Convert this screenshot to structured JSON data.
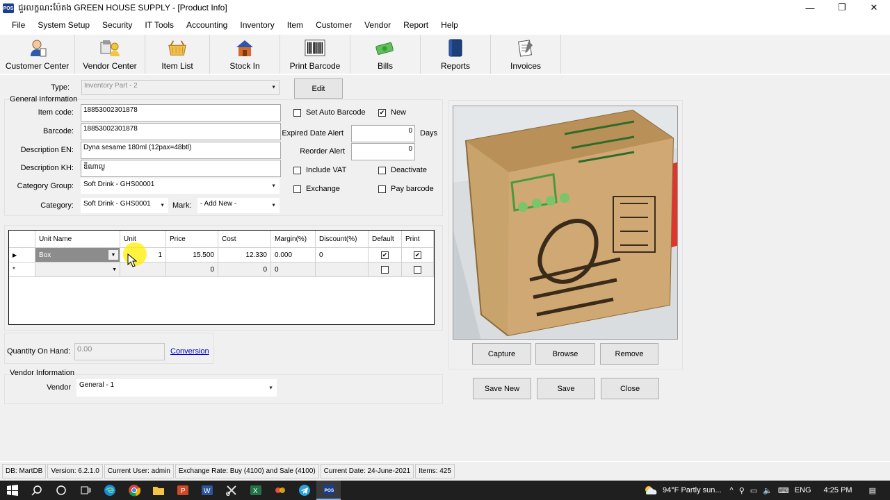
{
  "window": {
    "title": "ជួរលក្ខណះប៉ែតង GREEN HOUSE SUPPLY - [Product Info]",
    "app_icon": "POS",
    "controls": [
      "—",
      "❐",
      "✕"
    ]
  },
  "menu": [
    "File",
    "System Setup",
    "Security",
    "IT Tools",
    "Accounting",
    "Inventory",
    "Item",
    "Customer",
    "Vendor",
    "Report",
    "Help"
  ],
  "toolbar": [
    {
      "label": "Customer Center",
      "icon": "customer-icon"
    },
    {
      "label": "Vendor Center",
      "icon": "vendor-icon"
    },
    {
      "label": "Item List",
      "icon": "basket-icon"
    },
    {
      "label": "Stock In",
      "icon": "house-icon"
    },
    {
      "label": "Print Barcode",
      "icon": "barcode-icon"
    },
    {
      "label": "Bills",
      "icon": "money-icon"
    },
    {
      "label": "Reports",
      "icon": "book-icon"
    },
    {
      "label": "Invoices",
      "icon": "invoice-icon"
    }
  ],
  "form": {
    "type_label": "Type:",
    "type_value": "Inventory Part - 2",
    "edit_button": "Edit",
    "general_info": "General Information",
    "item_code_label": "Item code:",
    "item_code": "18853002301878",
    "barcode_label": "Barcode:",
    "barcode": "18853002301878",
    "desc_en_label": "Description EN:",
    "desc_en": "Dyna sesame 180ml (12pax=48btl)",
    "desc_kh_label": "Description KH:",
    "desc_kh": "ឌីណាល្ង",
    "category_group_label": "Category Group:",
    "category_group": "Soft Drink - GHS00001",
    "category_label": "Category:",
    "category": "Soft Drink  - GHS0001",
    "mark_label": "Mark:",
    "mark": "- Add New -",
    "set_auto_barcode": "Set Auto Barcode",
    "new_label": "New",
    "expired_alert_label": "Expired Date Alert",
    "expired_alert": "0",
    "days_label": "Days",
    "reorder_alert_label": "Reorder Alert",
    "reorder_alert": "0",
    "include_vat": "Include VAT",
    "deactivate": "Deactivate",
    "exchange": "Exchange",
    "pay_barcode": "Pay barcode",
    "qoh_label": "Quantity On Hand:",
    "qoh_value": "0.00",
    "conversion_link": "Conversion",
    "vendor_info": "Vendor Information",
    "vendor_label": "Vendor",
    "vendor_value": "General - 1"
  },
  "grid": {
    "headers": [
      "Unit Name",
      "Unit",
      "Price",
      "Cost",
      "Margin(%)",
      "Discount(%)",
      "Default",
      "Print"
    ],
    "rows": [
      {
        "marker": "▶",
        "unit_name": "Box",
        "unit": "1",
        "price": "15.500",
        "cost": "12.330",
        "margin": "0.000",
        "discount": "0",
        "default": true,
        "print": true
      },
      {
        "marker": "*",
        "unit_name": "",
        "unit": "",
        "price": "0",
        "cost": "0",
        "margin": "0",
        "discount": "",
        "default": false,
        "print": false
      }
    ]
  },
  "image_buttons": {
    "capture": "Capture",
    "browse": "Browse",
    "remove": "Remove"
  },
  "actions": {
    "save_new": "Save New",
    "save": "Save",
    "close": "Close"
  },
  "statusbar": [
    "DB: MartDB",
    "Version: 6.2.1.0",
    "Current User: admin",
    "Exchange Rate:  Buy (4100) and Sale (4100)",
    "Current Date: 24-June-2021",
    "Items: 425"
  ],
  "taskbar": {
    "weather": "94°F  Partly sun...",
    "lang": "ENG",
    "time": "4:25 PM"
  },
  "colors": {
    "accent_link": "#0000cc",
    "highlight": "#ffee00",
    "selected_cell": "#8c8c8c"
  }
}
